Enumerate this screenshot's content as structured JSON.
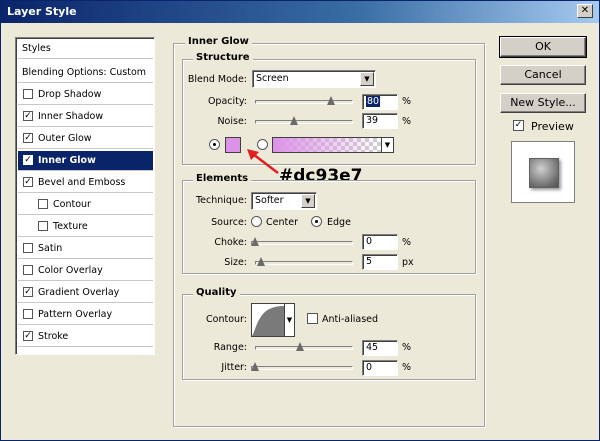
{
  "window": {
    "title": "Layer Style",
    "close_glyph": "✕"
  },
  "styles_panel": {
    "header": "Styles",
    "blending": "Blending Options: Custom",
    "items": [
      {
        "label": "Drop Shadow",
        "checked": false,
        "indent": false
      },
      {
        "label": "Inner Shadow",
        "checked": true,
        "indent": false
      },
      {
        "label": "Outer Glow",
        "checked": true,
        "indent": false
      },
      {
        "label": "Inner Glow",
        "checked": true,
        "indent": false,
        "selected": true
      },
      {
        "label": "Bevel and Emboss",
        "checked": true,
        "indent": false
      },
      {
        "label": "Contour",
        "checked": false,
        "indent": true
      },
      {
        "label": "Texture",
        "checked": false,
        "indent": true
      },
      {
        "label": "Satin",
        "checked": false,
        "indent": false
      },
      {
        "label": "Color Overlay",
        "checked": false,
        "indent": false
      },
      {
        "label": "Gradient Overlay",
        "checked": true,
        "indent": false
      },
      {
        "label": "Pattern Overlay",
        "checked": false,
        "indent": false
      },
      {
        "label": "Stroke",
        "checked": true,
        "indent": false
      }
    ]
  },
  "inner_glow": {
    "title": "Inner Glow",
    "structure": {
      "title": "Structure",
      "blend_mode_label": "Blend Mode:",
      "blend_mode_value": "Screen",
      "opacity_label": "Opacity:",
      "opacity_value": "80",
      "opacity_level": 0.8,
      "noise_label": "Noise:",
      "noise_value": "39",
      "noise_level": 0.39,
      "percent": "%",
      "color_mode": "solid",
      "glow_color": "#dc93e7"
    },
    "elements": {
      "title": "Elements",
      "technique_label": "Technique:",
      "technique_value": "Softer",
      "source_label": "Source:",
      "source_center": "Center",
      "source_edge": "Edge",
      "source_value": "Edge",
      "choke_label": "Choke:",
      "choke_value": "0",
      "choke_level": 0,
      "size_label": "Size:",
      "size_value": "5",
      "size_level": 0.02,
      "percent": "%",
      "px": "px"
    },
    "quality": {
      "title": "Quality",
      "contour_label": "Contour:",
      "anti_aliased_label": "Anti-aliased",
      "anti_aliased": false,
      "range_label": "Range:",
      "range_value": "45",
      "range_level": 0.45,
      "jitter_label": "Jitter:",
      "jitter_value": "0",
      "jitter_level": 0,
      "percent": "%"
    }
  },
  "buttons": {
    "ok": "OK",
    "cancel": "Cancel",
    "new_style": "New Style...",
    "preview_label": "Preview",
    "preview_checked": true
  },
  "annotation": {
    "text": "#dc93e7",
    "arrow_color": "#e02020"
  },
  "icons": {
    "dropdown": "triangle-down-icon",
    "check": "checkmark-icon",
    "close": "close-icon"
  }
}
